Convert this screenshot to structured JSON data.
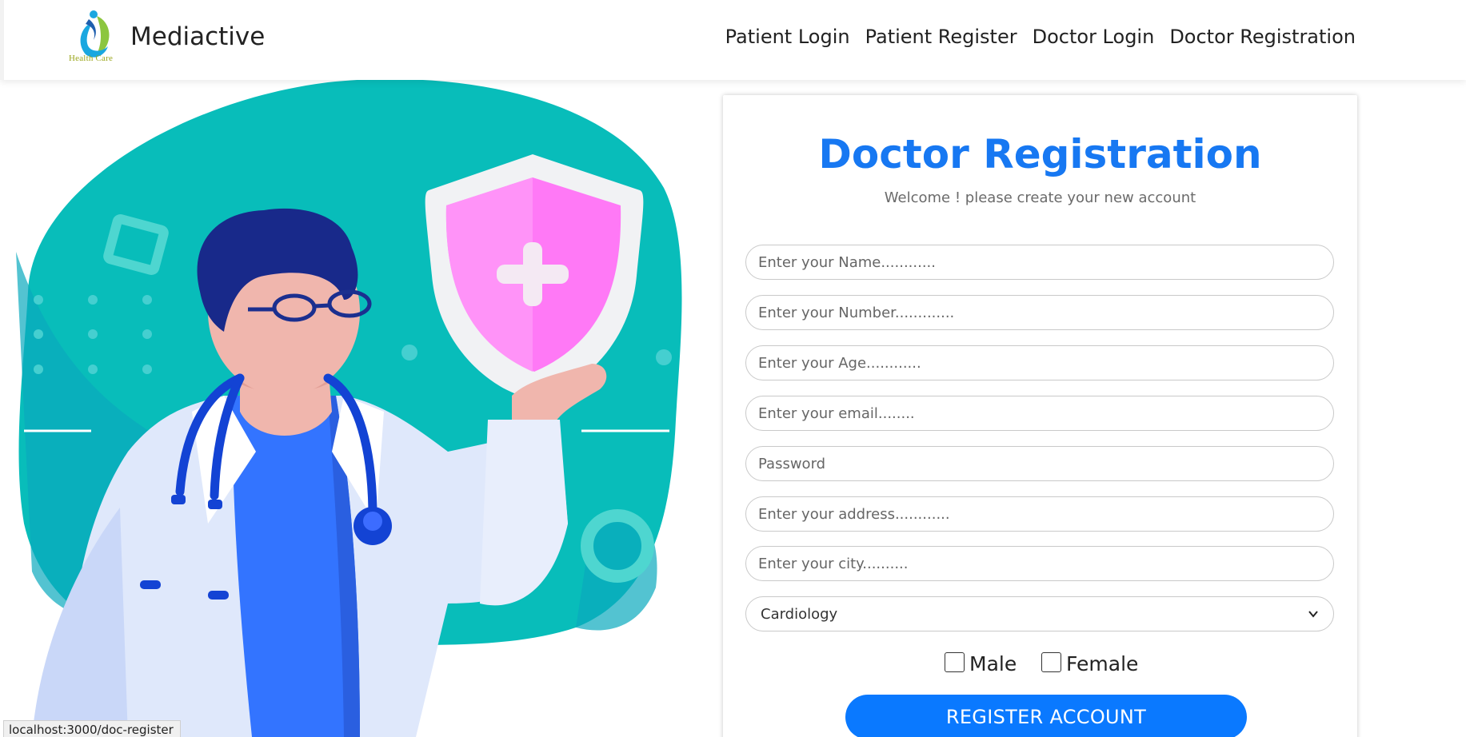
{
  "navbar": {
    "logo_caption": "Health Care",
    "brand": "Mediactive",
    "links": [
      "Patient Login",
      "Patient Register",
      "Doctor Login",
      "Doctor Registration"
    ]
  },
  "form": {
    "title": "Doctor Registration",
    "subtitle": "Welcome ! please create your new account",
    "name_placeholder": "Enter your Name............",
    "number_placeholder": "Enter your Number.............",
    "age_placeholder": "Enter your Age............",
    "email_placeholder": "Enter your email........",
    "password_placeholder": "Password",
    "address_placeholder": "Enter your address............",
    "city_placeholder": "Enter your city..........",
    "specialty_selected": "Cardiology",
    "gender_male": "Male",
    "gender_female": "Female",
    "register_label": "REGISTER ACCOUNT"
  },
  "status_bar": {
    "url": "localhost:3000/doc-register"
  },
  "colors": {
    "accent": "#1778f2",
    "button": "#0a79ff",
    "illustration_teal": "#08bdba",
    "shield_pink": "#ff79f6"
  }
}
